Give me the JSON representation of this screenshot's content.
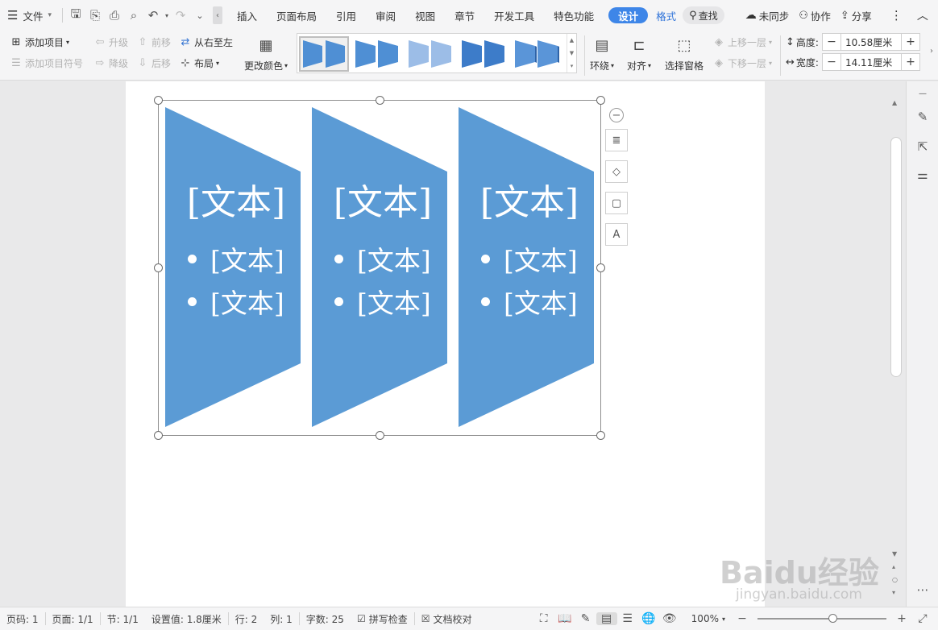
{
  "menubar": {
    "file_label": "文件",
    "tabs": [
      "插入",
      "页面布局",
      "引用",
      "审阅",
      "视图",
      "章节",
      "开发工具",
      "特色功能"
    ],
    "design_tab": "设计",
    "format_tab": "格式",
    "search_label": "查找",
    "sync_label": "未同步",
    "collab_label": "协作",
    "share_label": "分享"
  },
  "ribbon": {
    "add_item": "添加项目",
    "add_bullet": "添加项目符号",
    "promote": "升级",
    "demote": "降级",
    "move_forward": "前移",
    "move_backward": "后移",
    "right_to_left": "从右至左",
    "layout": "布局",
    "change_color": "更改颜色",
    "wrap": "环绕",
    "align": "对齐",
    "selection_pane": "选择窗格",
    "bring_forward": "上移一层",
    "send_backward": "下移一层",
    "height_label": "高度:",
    "height_value": "10.58厘米",
    "width_label": "宽度:",
    "width_value": "14.11厘米"
  },
  "smartart": {
    "color": "#5b9bd5",
    "shapes": [
      {
        "title": "[文本]",
        "bullets": [
          "[文本]",
          "[文本]"
        ]
      },
      {
        "title": "[文本]",
        "bullets": [
          "[文本]",
          "[文本]"
        ]
      },
      {
        "title": "[文本]",
        "bullets": [
          "[文本]",
          "[文本]"
        ]
      }
    ]
  },
  "statusbar": {
    "page_num": "页码: 1",
    "pages": "页面: 1/1",
    "section": "节: 1/1",
    "setting": "设置值: 1.8厘米",
    "row": "行: 2",
    "col": "列: 1",
    "word_count": "字数: 25",
    "spell_check": "拼写检查",
    "doc_proof": "文档校对",
    "zoom": "100%"
  },
  "watermark": {
    "brand": "Baidu经验",
    "url": "jingyan.baidu.com"
  }
}
